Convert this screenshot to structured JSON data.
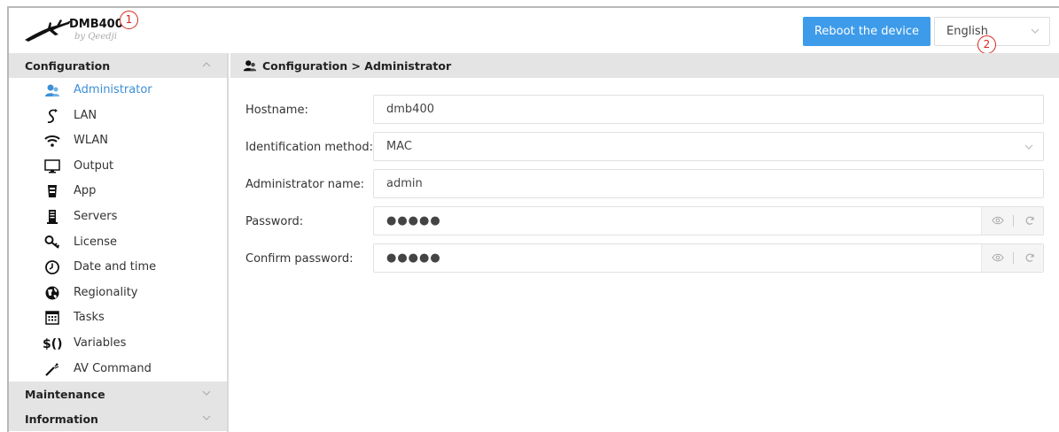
{
  "header": {
    "app_name": "DMB400",
    "app_subtitle": "by Qeedji",
    "reboot_label": "Reboot the device",
    "language_value": "English",
    "callouts": [
      "1",
      "2"
    ]
  },
  "sidebar": {
    "sections": [
      {
        "label": "Configuration",
        "expanded": true
      },
      {
        "label": "Maintenance",
        "expanded": false
      },
      {
        "label": "Information",
        "expanded": false
      }
    ],
    "items": [
      {
        "label": "Administrator",
        "icon": "administrator-icon",
        "active": true
      },
      {
        "label": "LAN",
        "icon": "lan-icon"
      },
      {
        "label": "WLAN",
        "icon": "wifi-icon"
      },
      {
        "label": "Output",
        "icon": "monitor-icon"
      },
      {
        "label": "App",
        "icon": "app-icon"
      },
      {
        "label": "Servers",
        "icon": "server-icon"
      },
      {
        "label": "License",
        "icon": "key-icon"
      },
      {
        "label": "Date and time",
        "icon": "clock-icon"
      },
      {
        "label": "Regionality",
        "icon": "globe-icon"
      },
      {
        "label": "Tasks",
        "icon": "calendar-icon"
      },
      {
        "label": "Variables",
        "icon": "variables-icon"
      },
      {
        "label": "AV Command",
        "icon": "av-command-icon"
      }
    ]
  },
  "main": {
    "breadcrumb": "Configuration > Administrator",
    "fields": {
      "hostname": {
        "label": "Hostname:",
        "value": "dmb400"
      },
      "identification_method": {
        "label": "Identification method:",
        "value": "MAC"
      },
      "administrator_name": {
        "label": "Administrator name:",
        "value": "admin"
      },
      "password": {
        "label": "Password:",
        "value": "●●●●●"
      },
      "confirm_password": {
        "label": "Confirm password:",
        "value": "●●●●●"
      }
    }
  },
  "colors": {
    "accent": "#3d9bea",
    "active_item": "#3d8fd6",
    "section_bg": "#e4e4e4",
    "callout": "#d9261c"
  }
}
